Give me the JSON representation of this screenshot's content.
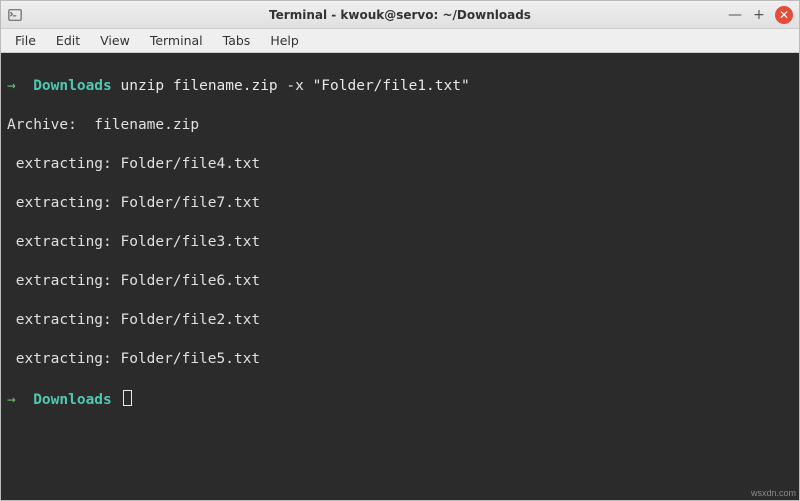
{
  "window": {
    "title": "Terminal - kwouk@servo: ~/Downloads"
  },
  "menubar": {
    "items": [
      "File",
      "Edit",
      "View",
      "Terminal",
      "Tabs",
      "Help"
    ]
  },
  "terminal": {
    "prompt_arrow": "→",
    "cwd": "Downloads",
    "command": "unzip filename.zip -x \"Folder/file1.txt\"",
    "archive_label": "Archive:  filename.zip",
    "extract_lines": [
      " extracting: Folder/file4.txt",
      " extracting: Folder/file7.txt",
      " extracting: Folder/file3.txt",
      " extracting: Folder/file6.txt",
      " extracting: Folder/file2.txt",
      " extracting: Folder/file5.txt"
    ],
    "prompt2_cwd": "Downloads"
  },
  "controls": {
    "minimize": "—",
    "maximize": "+",
    "close": "✕"
  },
  "watermark": "wsxdn.com"
}
